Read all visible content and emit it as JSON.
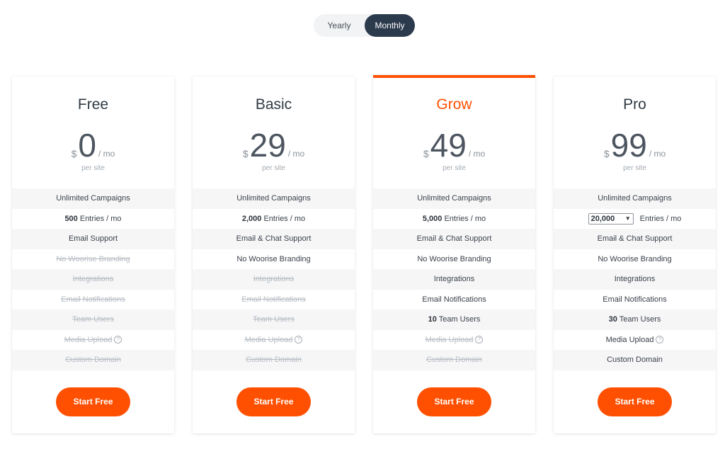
{
  "toggle": {
    "yearly": "Yearly",
    "monthly": "Monthly",
    "selected": "Monthly"
  },
  "accent_color": "#ff4f00",
  "plans": [
    {
      "name": "Free",
      "currency": "$",
      "amount": "0",
      "period": "/ mo",
      "per_site": "per site",
      "features": [
        {
          "text": "Unlimited Campaigns",
          "enabled": true
        },
        {
          "bold": "500",
          "text": " Entries / mo",
          "enabled": true
        },
        {
          "text": "Email Support",
          "enabled": true
        },
        {
          "text": "No Woorise Branding",
          "enabled": false
        },
        {
          "text": "Integrations",
          "enabled": false
        },
        {
          "text": "Email Notifications",
          "enabled": false
        },
        {
          "text": "Team Users",
          "enabled": false
        },
        {
          "text": "Media Upload",
          "enabled": false,
          "help_icon": "?"
        },
        {
          "text": "Custom Domain",
          "enabled": false
        }
      ],
      "button": "Start Free"
    },
    {
      "name": "Basic",
      "currency": "$",
      "amount": "29",
      "period": "/ mo",
      "per_site": "per site",
      "features": [
        {
          "text": "Unlimited Campaigns",
          "enabled": true
        },
        {
          "bold": "2,000",
          "text": " Entries / mo",
          "enabled": true
        },
        {
          "text": "Email & Chat Support",
          "enabled": true
        },
        {
          "text": "No Woorise Branding",
          "enabled": true
        },
        {
          "text": "Integrations",
          "enabled": false
        },
        {
          "text": "Email Notifications",
          "enabled": false
        },
        {
          "text": "Team Users",
          "enabled": false
        },
        {
          "text": "Media Upload",
          "enabled": false,
          "help_icon": "?"
        },
        {
          "text": "Custom Domain",
          "enabled": false
        }
      ],
      "button": "Start Free"
    },
    {
      "name": "Grow",
      "currency": "$",
      "amount": "49",
      "period": "/ mo",
      "per_site": "per site",
      "featured": true,
      "features": [
        {
          "text": "Unlimited Campaigns",
          "enabled": true
        },
        {
          "bold": "5,000",
          "text": " Entries / mo",
          "enabled": true
        },
        {
          "text": "Email & Chat Support",
          "enabled": true
        },
        {
          "text": "No Woorise Branding",
          "enabled": true
        },
        {
          "text": "Integrations",
          "enabled": true
        },
        {
          "text": "Email Notifications",
          "enabled": true
        },
        {
          "bold": "10",
          "text": " Team Users",
          "enabled": true
        },
        {
          "text": "Media Upload",
          "enabled": false,
          "help_icon": "?"
        },
        {
          "text": "Custom Domain",
          "enabled": false
        }
      ],
      "button": "Start Free"
    },
    {
      "name": "Pro",
      "currency": "$",
      "amount": "99",
      "period": "/ mo",
      "per_site": "per site",
      "features": [
        {
          "text": "Unlimited Campaigns",
          "enabled": true
        },
        {
          "select": "20,000",
          "text": " Entries / mo",
          "enabled": true
        },
        {
          "text": "Email & Chat Support",
          "enabled": true
        },
        {
          "text": "No Woorise Branding",
          "enabled": true
        },
        {
          "text": "Integrations",
          "enabled": true
        },
        {
          "text": "Email Notifications",
          "enabled": true
        },
        {
          "bold": "30",
          "text": " Team Users",
          "enabled": true
        },
        {
          "text": "Media Upload",
          "enabled": true,
          "help_icon": "?"
        },
        {
          "text": "Custom Domain",
          "enabled": true
        }
      ],
      "button": "Start Free"
    }
  ]
}
